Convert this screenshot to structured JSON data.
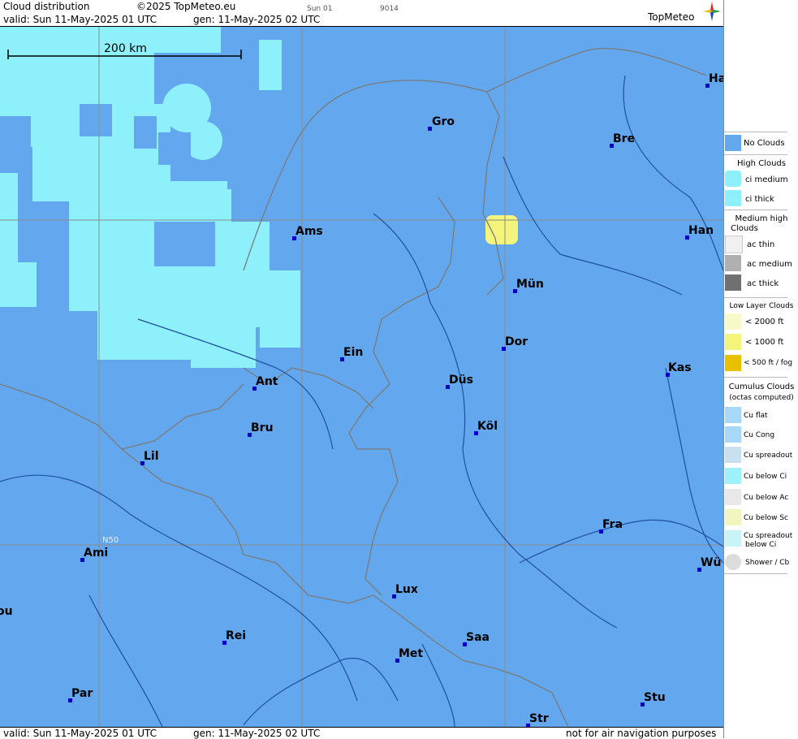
{
  "header": {
    "title": "Cloud distribution",
    "copyright": "©2025 TopMeteo.eu",
    "run": "Sun 01",
    "code": "9014",
    "valid_label": "valid:  Sun  11-May-2025  01 UTC",
    "gen_label": "gen: 11-May-2025 02 UTC",
    "logo": "TopMeteo"
  },
  "footer": {
    "valid_label": "valid:  Sun  11-May-2025  01 UTC",
    "gen_label": "gen: 11-May-2025 02 UTC",
    "disclaimer": "not for air navigation purposes"
  },
  "map": {
    "scale_label": "200 km",
    "lat_label": "N50",
    "colors": {
      "no_clouds": "#63a8ee",
      "ci_medium": "#8ef0fa",
      "low_yellow": "#f3f57a",
      "border": "#7a7a7a",
      "river": "#1f4fa0",
      "grid": "#8a8a8a"
    },
    "cities": [
      {
        "name": "Gro"
      },
      {
        "name": "Bre"
      },
      {
        "name": "Ha"
      },
      {
        "name": "Ams"
      },
      {
        "name": "Han"
      },
      {
        "name": "Mün"
      },
      {
        "name": "Dor"
      },
      {
        "name": "Ein"
      },
      {
        "name": "Ant"
      },
      {
        "name": "Düs"
      },
      {
        "name": "Kas"
      },
      {
        "name": "Köl"
      },
      {
        "name": "Bru"
      },
      {
        "name": "Lil"
      },
      {
        "name": "Fra"
      },
      {
        "name": "Ami"
      },
      {
        "name": "Wü"
      },
      {
        "name": "Lux"
      },
      {
        "name": "ou"
      },
      {
        "name": "Rei"
      },
      {
        "name": "Saa"
      },
      {
        "name": "Met"
      },
      {
        "name": "Par"
      },
      {
        "name": "Stu"
      },
      {
        "name": "Str"
      }
    ]
  },
  "legend": {
    "no_clouds": "No Clouds",
    "high_head": "High Clouds",
    "ci_medium": "ci medium",
    "ci_thick": "ci thick",
    "medium_head_1": "Medium high",
    "medium_head_2": "Clouds",
    "ac_thin": "ac thin",
    "ac_medium": "ac medium",
    "ac_thick": "ac thick",
    "low_head": "Low Layer Clouds",
    "low_2000": "< 2000 ft",
    "low_1000": "< 1000 ft",
    "low_500": "< 500 ft / fog",
    "cu_head_1": "Cumulus Clouds",
    "cu_head_2": "(octas computed)",
    "cu_flat": "Cu flat",
    "cu_cong": "Cu Cong",
    "cu_spreadout": "Cu spreadout",
    "cu_below_ci": "Cu below Ci",
    "cu_below_ac": "Cu below Ac",
    "cu_below_sc": "Cu below Sc",
    "cu_spread_ci_1": "Cu spreadout",
    "cu_spread_ci_2": "below Ci",
    "shower": "Shower / Cb"
  }
}
